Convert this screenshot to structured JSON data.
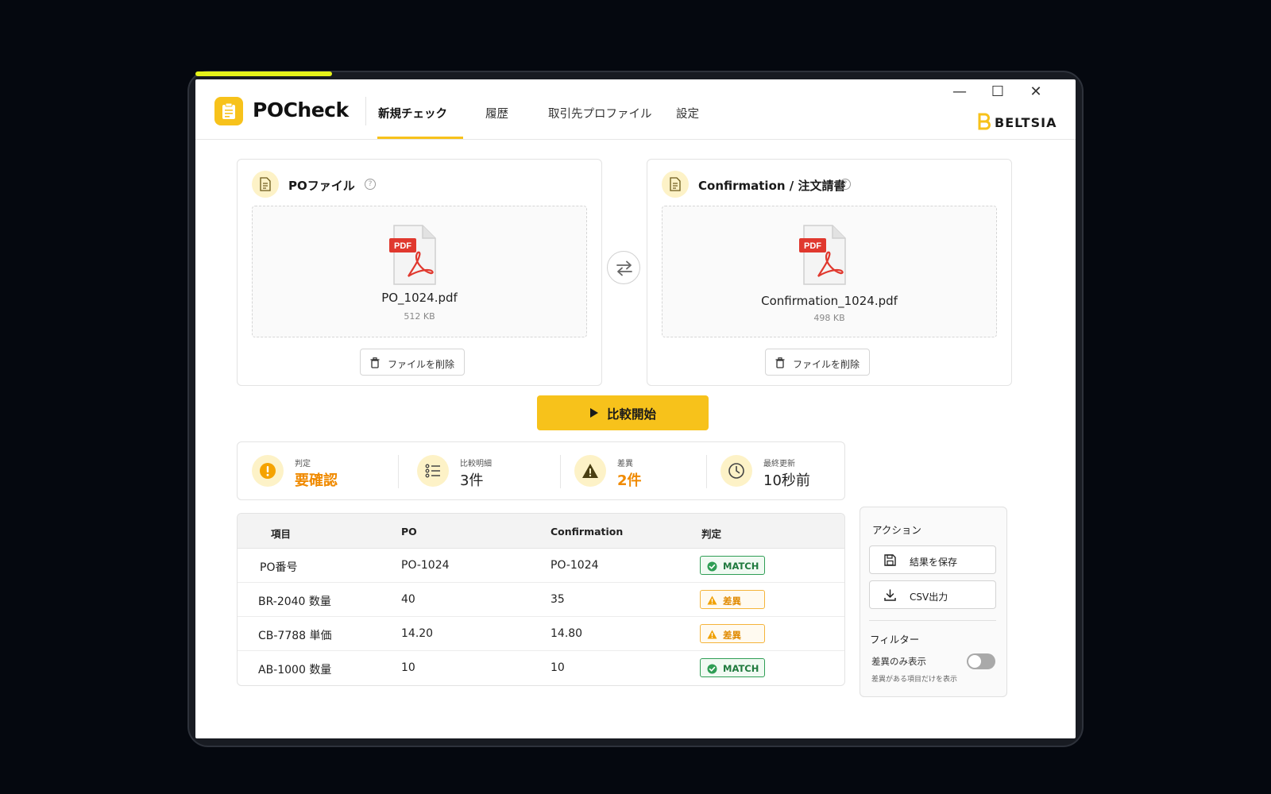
{
  "app": {
    "title": "POCheck",
    "brand": "BELTSIA",
    "accent": "#f7c21b",
    "warn_color": "#f08a00",
    "match_color": "#2f9e55"
  },
  "tabs": [
    {
      "label": "新規チェック",
      "active": true
    },
    {
      "label": "履歴",
      "active": false
    },
    {
      "label": "取引先プロファイル",
      "active": false
    },
    {
      "label": "設定",
      "active": false
    }
  ],
  "window_controls": {
    "minimize": "—",
    "maximize": "☐",
    "close": "✕"
  },
  "po_card": {
    "title": "POファイル",
    "help": "?",
    "file_badge": "PDF",
    "file_name": "PO_1024.pdf",
    "file_size": "512 KB",
    "delete_label": "ファイルを削除"
  },
  "conf_card": {
    "title": "Confirmation / 注文請書",
    "help": "?",
    "file_badge": "PDF",
    "file_name": "Confirmation_1024.pdf",
    "file_size": "498 KB",
    "delete_label": "ファイルを削除"
  },
  "start_button": {
    "label": "比較開始"
  },
  "summary": {
    "judgement": {
      "label": "判定",
      "value": "要確認",
      "icon": "exclamation-icon"
    },
    "details": {
      "label": "比較明細",
      "value": "3件",
      "icon": "list-icon"
    },
    "diffs": {
      "label": "差異",
      "value": "2件",
      "icon": "warning-icon"
    },
    "updated": {
      "label": "最終更新",
      "value": "10秒前",
      "icon": "clock-icon"
    }
  },
  "table": {
    "headers": [
      "項目",
      "PO",
      "Confirmation",
      "判定"
    ],
    "rows": [
      {
        "item": "PO番号",
        "po": "PO-1024",
        "conf": "PO-1024",
        "status": "MATCH",
        "type": "match"
      },
      {
        "item": "BR-2040 数量",
        "po": "40",
        "conf": "35",
        "status": "差異",
        "type": "diff"
      },
      {
        "item": "CB-7788 単価",
        "po": "14.20",
        "conf": "14.80",
        "status": "差異",
        "type": "diff"
      },
      {
        "item": "AB-1000 数量",
        "po": "10",
        "conf": "10",
        "status": "MATCH",
        "type": "match"
      }
    ]
  },
  "actions": {
    "title": "アクション",
    "save_label": "結果を保存",
    "csv_label": "CSV出力",
    "filter_title": "フィルター",
    "filter_label": "差異のみ表示",
    "filter_hint": "差異がある項目だけを表示",
    "filter_on": false
  }
}
